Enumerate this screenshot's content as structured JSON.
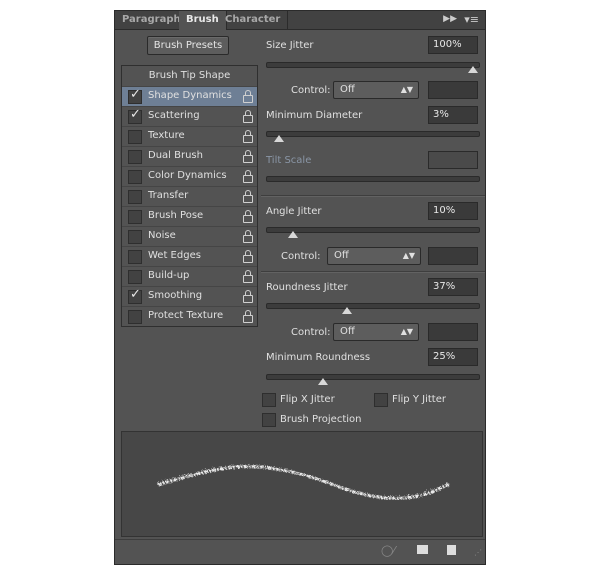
{
  "tabs": [
    {
      "label": "Paragraph",
      "active": false
    },
    {
      "label": "Brush",
      "active": true
    },
    {
      "label": "Character",
      "active": false
    }
  ],
  "brush_presets_label": "Brush Presets",
  "tip_shape_label": "Brush Tip Shape",
  "items": [
    {
      "label": "Shape Dynamics",
      "checked": true,
      "selected": true
    },
    {
      "label": "Scattering",
      "checked": true
    },
    {
      "label": "Texture",
      "checked": false
    },
    {
      "label": "Dual Brush",
      "checked": false
    },
    {
      "label": "Color Dynamics",
      "checked": false
    },
    {
      "label": "Transfer",
      "checked": false
    },
    {
      "label": "Brush Pose",
      "checked": false
    },
    {
      "label": "Noise",
      "checked": false
    },
    {
      "label": "Wet Edges",
      "checked": false
    },
    {
      "label": "Build-up",
      "checked": false
    },
    {
      "label": "Smoothing",
      "checked": true
    },
    {
      "label": "Protect Texture",
      "checked": false
    }
  ],
  "size_jitter": {
    "label": "Size Jitter",
    "value": "100%",
    "percent": 100
  },
  "control_label": "Control:",
  "control1": "Off",
  "min_diameter": {
    "label": "Minimum Diameter",
    "value": "3%",
    "percent": 3
  },
  "tilt_scale": {
    "label": "Tilt Scale",
    "value": ""
  },
  "angle_jitter": {
    "label": "Angle Jitter",
    "value": "10%",
    "percent": 10
  },
  "control2": "Off",
  "roundness_jitter": {
    "label": "Roundness Jitter",
    "value": "37%",
    "percent": 37
  },
  "control3": "Off",
  "min_roundness": {
    "label": "Minimum Roundness",
    "value": "25%",
    "percent": 25
  },
  "flip_x": {
    "label": "Flip X Jitter",
    "checked": false
  },
  "flip_y": {
    "label": "Flip Y Jitter",
    "checked": false
  },
  "brush_projection": {
    "label": "Brush Projection",
    "checked": false
  },
  "colors": {
    "panel": "#535353",
    "selection": "#6e7f95"
  }
}
